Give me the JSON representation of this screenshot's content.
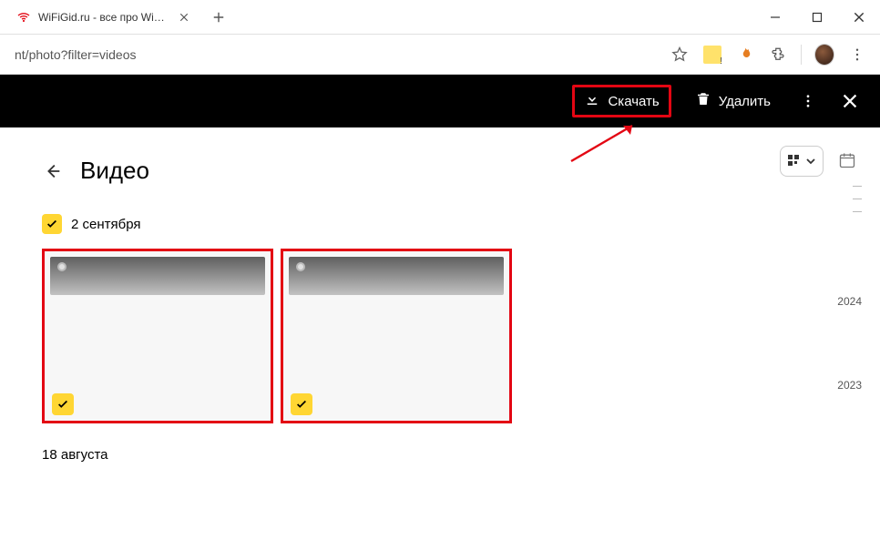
{
  "browser": {
    "tab_title": "WiFiGid.ru - все про WiFi и бе",
    "url": "nt/photo?filter=videos"
  },
  "action_bar": {
    "download_label": "Скачать",
    "delete_label": "Удалить"
  },
  "page": {
    "title": "Видео",
    "date1": "2 сентября",
    "date2": "18 августа"
  },
  "timeline": {
    "year1": "2024",
    "year2": "2023"
  }
}
